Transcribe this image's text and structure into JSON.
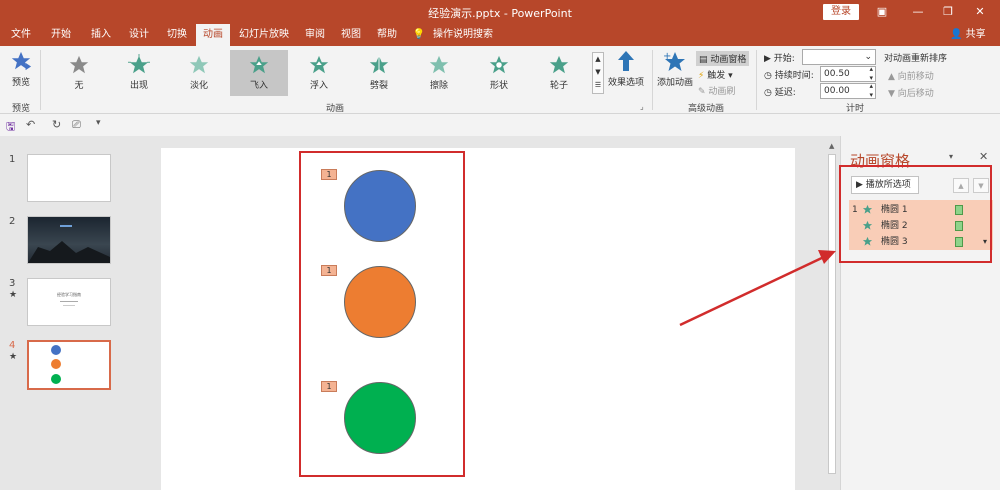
{
  "titlebar": {
    "title": "经验演示.pptx - PowerPoint",
    "login": "登录"
  },
  "tabs": [
    "文件",
    "开始",
    "插入",
    "设计",
    "切换",
    "动画",
    "幻灯片放映",
    "审阅",
    "视图",
    "帮助",
    "操作说明搜索"
  ],
  "share": "共享",
  "ribbon": {
    "preview_label": "预览",
    "preview_group": "预览",
    "effects": [
      "无",
      "出现",
      "淡化",
      "飞入",
      "浮入",
      "劈裂",
      "擦除",
      "形状",
      "轮子"
    ],
    "animation_group": "动画",
    "effect_options": "效果选项",
    "add_animation": "添加动画",
    "animation_pane_btn": "动画窗格",
    "trigger": "触发",
    "animation_painter": "动画刷",
    "advanced_group": "高级动画",
    "start_label": "开始:",
    "duration_label": "持续时间:",
    "duration_value": "00.50",
    "delay_label": "延迟:",
    "delay_value": "00.00",
    "timing_group": "计时",
    "reorder_title": "对动画重新排序",
    "move_earlier": "向前移动",
    "move_later": "向后移动"
  },
  "thumbnails": {
    "numbers": [
      "1",
      "2",
      "3",
      "4"
    ],
    "slide3_title": "经验学习指南"
  },
  "slide": {
    "anim_tags": [
      "1",
      "1",
      "1"
    ],
    "circle_colors": [
      "#4472c4",
      "#ed7d31",
      "#00b050"
    ]
  },
  "anim_pane": {
    "title": "动画窗格",
    "play_button": "播放所选项",
    "items": [
      {
        "index": "1",
        "name": "椭圆 1"
      },
      {
        "index": "",
        "name": "椭圆 2"
      },
      {
        "index": "",
        "name": "椭圆 3"
      }
    ]
  },
  "colors": {
    "accent": "#b7472a",
    "highlight": "#d12c2c",
    "star": "#4aa08a"
  }
}
